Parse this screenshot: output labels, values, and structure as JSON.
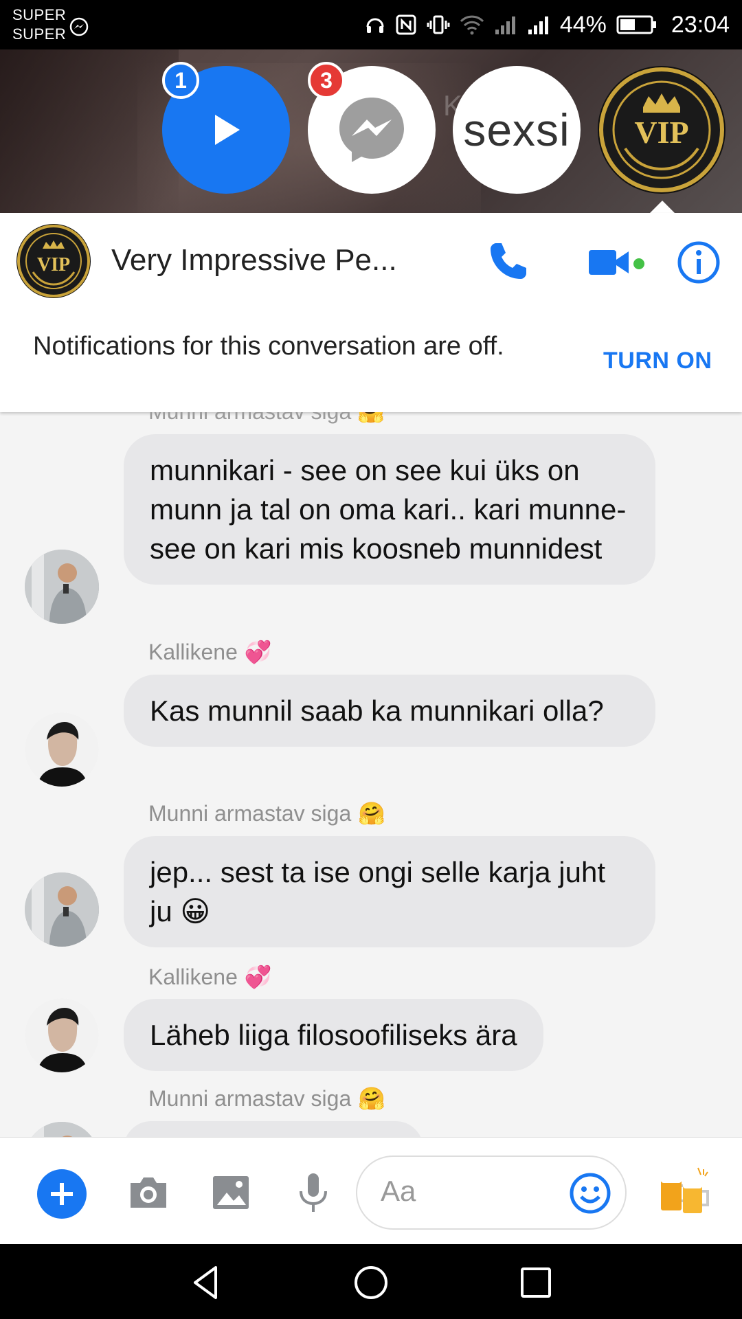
{
  "status_bar": {
    "carrier_line1": "SUPER",
    "carrier_line2": "SUPER",
    "battery_percent": "44%",
    "time": "23:04"
  },
  "chat_heads": {
    "faded_background_text": "K          re",
    "play_badge": "1",
    "messenger_badge": "3",
    "sexsi_label": "sexsi",
    "vip_label": "VIP"
  },
  "header": {
    "title": "Very Impressive Pe...",
    "avatar_label": "VIP",
    "notification_text": "Notifications for this conversation are off.",
    "turn_on_label": "TURN ON",
    "colors": {
      "accent": "#1877f2",
      "online": "#44c146"
    }
  },
  "messages": {
    "cut_sender": "Munni armastav siga",
    "items": [
      {
        "text": "munnikari - see on see kui üks on munn ja tal on oma kari..  kari munne- see on kari mis koosneb munnidest"
      },
      {
        "sender": "Kallikene",
        "emoji": "💞",
        "text": "Kas munnil saab ka munnikari olla?"
      },
      {
        "sender": "Munni armastav siga",
        "emoji": "🤗",
        "text": "jep... sest ta ise ongi selle karja juht ju 😀"
      },
      {
        "sender": "Kallikene",
        "emoji": "💞",
        "text": "Läheb liiga filosoofiliseks ära"
      },
      {
        "sender": "Munni armastav siga",
        "emoji": "🤗"
      }
    ]
  },
  "composer": {
    "placeholder": "Aa"
  }
}
